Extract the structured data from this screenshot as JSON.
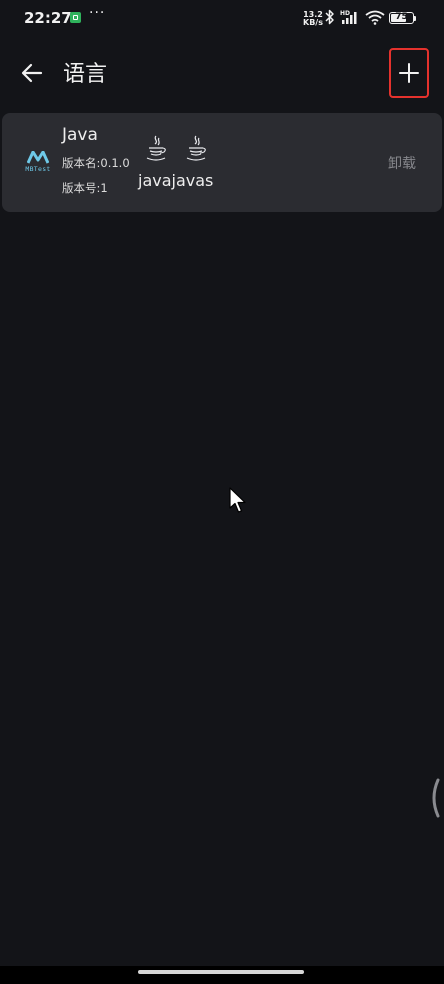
{
  "status_bar": {
    "time": "22:27",
    "more": "···",
    "net_speed_value": "13.2",
    "net_speed_unit": "KB/s",
    "hd": "HD",
    "battery_level": "75"
  },
  "app_bar": {
    "title": "语言",
    "back_icon": "arrow-left-icon",
    "add_icon": "plus-icon"
  },
  "languages": [
    {
      "logo_text": "MBTest",
      "name": "Java",
      "version_name": "版本名:0.1.0",
      "version_code": "版本号:1",
      "extensions": [
        "java",
        "javas"
      ],
      "action": "卸载"
    }
  ],
  "colors": {
    "background": "#131418",
    "card": "#2b2c31",
    "highlight": "#e5322d",
    "logo": "#6ec9e8"
  }
}
